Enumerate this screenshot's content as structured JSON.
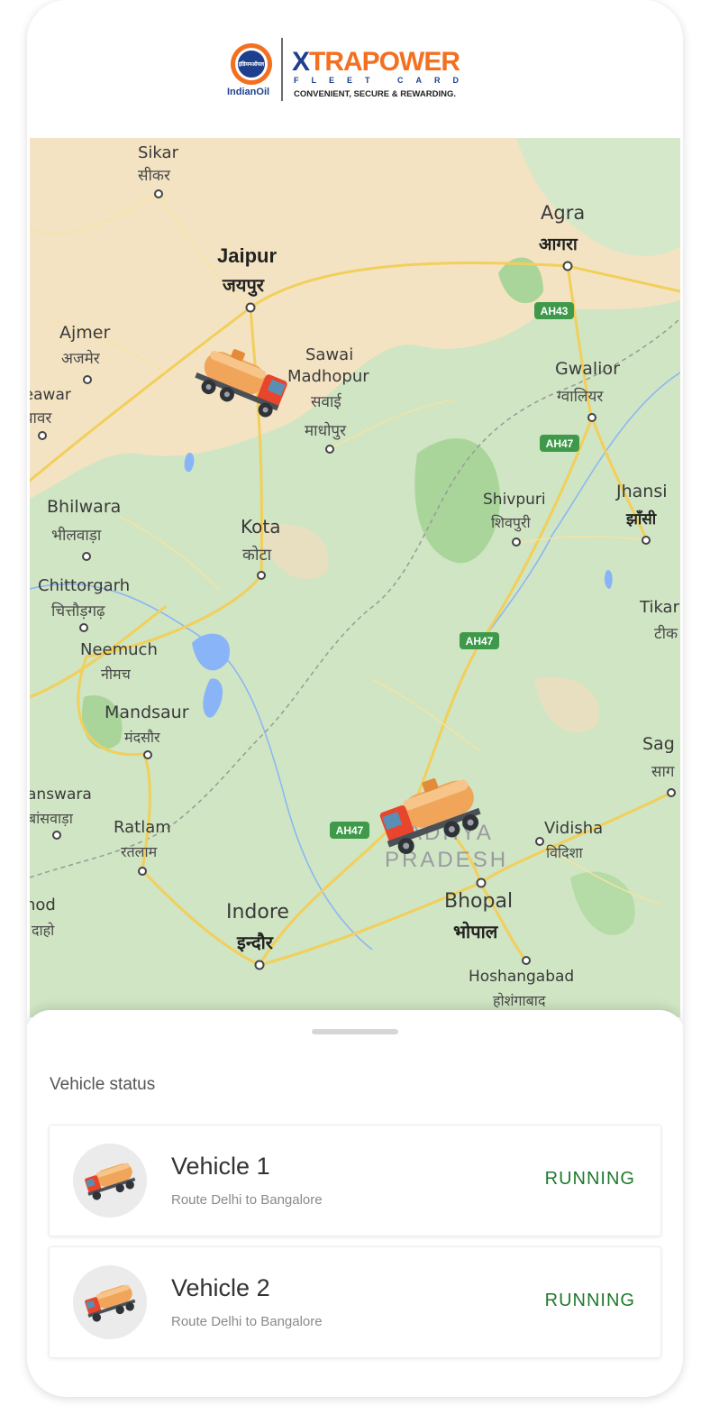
{
  "brand": {
    "indianoil_hindi": "इंडियनऑयल",
    "indianoil_label": "IndianOil",
    "xtrapower_title": "XTRAPOWER",
    "fleet_card": "FLEET CARD",
    "tagline": "CONVENIENT, SECURE & REWARDING.",
    "colors": {
      "orange": "#f37021",
      "navy": "#1d3f8e"
    }
  },
  "map": {
    "cities": [
      {
        "en": "Sikar",
        "hi": "सीकर"
      },
      {
        "en": "Jaipur",
        "hi": "जयपुर"
      },
      {
        "en": "Agra",
        "hi": "आगरा"
      },
      {
        "en": "Ajmer",
        "hi": "अजमेर"
      },
      {
        "en": "Sawai Madhopur",
        "hi": "सवाई माधोपुर"
      },
      {
        "en": "Gwalior",
        "hi": "ग्वालियर"
      },
      {
        "en": "Beawar",
        "hi": "ब्यावर"
      },
      {
        "en": "Bhilwara",
        "hi": "भीलवाड़ा"
      },
      {
        "en": "Kota",
        "hi": "कोटा"
      },
      {
        "en": "Shivpuri",
        "hi": "शिवपुरी"
      },
      {
        "en": "Jhansi",
        "hi": "झाँसी"
      },
      {
        "en": "Chittorgarh",
        "hi": "चित्तौड़गढ़"
      },
      {
        "en": "Neemuch",
        "hi": "नीमच"
      },
      {
        "en": "Tikamgarh",
        "hi": "टीक"
      },
      {
        "en": "Mandsaur",
        "hi": "मंदसौर"
      },
      {
        "en": "Sagar",
        "hi": "साग"
      },
      {
        "en": "Banswara",
        "hi": "बांसवाड़ा"
      },
      {
        "en": "Ratlam",
        "hi": "रतलाम"
      },
      {
        "en": "Vidisha",
        "hi": "विदिशा"
      },
      {
        "en": "Dahod",
        "hi": "दाहोद"
      },
      {
        "en": "Indore",
        "hi": "इन्दौर"
      },
      {
        "en": "Bhopal",
        "hi": "भोपाल"
      },
      {
        "en": "Hoshangabad",
        "hi": "होशंगाबाद"
      }
    ],
    "state_label": [
      "MADHYA",
      "PRADESH"
    ],
    "highways": [
      "AH43",
      "AH47",
      "AH47",
      "AH47"
    ],
    "markers": [
      "vehicle-1-marker",
      "vehicle-2-marker"
    ],
    "colors": {
      "land": "#cfe5c3",
      "sand": "#f3e3c2",
      "road": "#f7d774",
      "water": "#8ab4f8"
    }
  },
  "sheet": {
    "title": "Vehicle status",
    "vehicles": [
      {
        "name": "Vehicle 1",
        "route": "Route Delhi to Bangalore",
        "status": "RUNNING",
        "icon": "tanker-truck-icon"
      },
      {
        "name": "Vehicle 2",
        "route": "Route Delhi to Bangalore",
        "status": "RUNNING",
        "icon": "tanker-truck-icon"
      }
    ],
    "status_color": "#1f7a2e"
  }
}
